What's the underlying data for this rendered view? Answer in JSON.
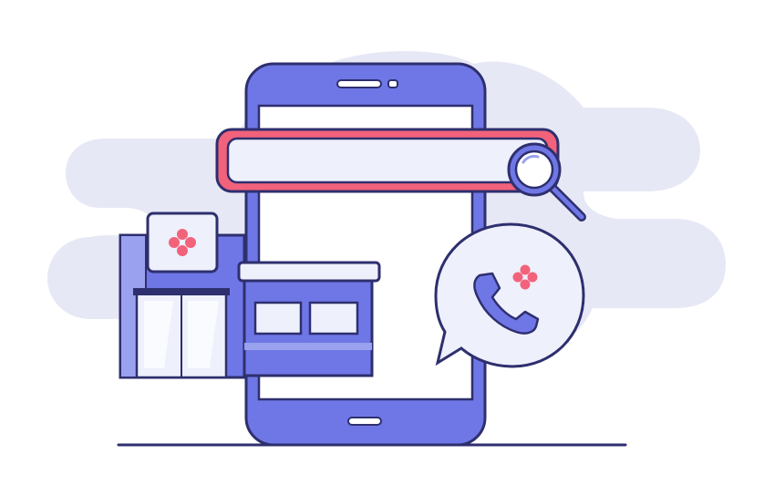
{
  "illustration": {
    "subject": "pharmacy-search-on-phone",
    "icons": [
      "smartphone-icon",
      "search-bar-icon",
      "magnifier-icon",
      "pharmacy-store-icon",
      "medical-cross-icon",
      "phone-call-icon",
      "speech-bubble-icon",
      "cloud-icon"
    ]
  },
  "colors": {
    "background": "#ffffff",
    "cloud": "#e7e8f5",
    "outline": "#2e2f6e",
    "primary": "#6f77e6",
    "primary_light": "#9aa1ee",
    "panel": "#eef0fb",
    "screen": "#ffffff",
    "accent": "#f2627b",
    "accent_light": "#f8a1b0"
  }
}
